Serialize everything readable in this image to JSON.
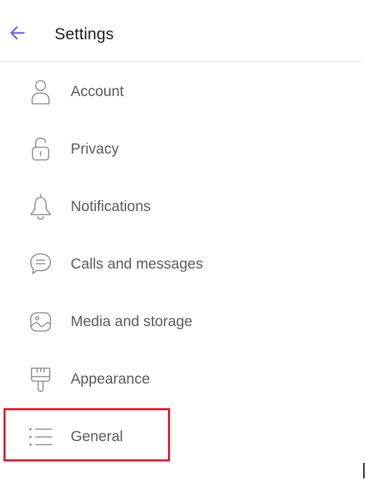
{
  "header": {
    "title": "Settings",
    "back_icon": "arrow-left-icon",
    "accent_color": "#7360f2"
  },
  "menu": {
    "items": [
      {
        "id": "account",
        "label": "Account",
        "icon": "person-icon"
      },
      {
        "id": "privacy",
        "label": "Privacy",
        "icon": "lock-icon"
      },
      {
        "id": "notifications",
        "label": "Notifications",
        "icon": "bell-icon"
      },
      {
        "id": "calls-messages",
        "label": "Calls and messages",
        "icon": "chat-bubble-icon"
      },
      {
        "id": "media-storage",
        "label": "Media and storage",
        "icon": "image-icon"
      },
      {
        "id": "appearance",
        "label": "Appearance",
        "icon": "paint-brush-icon"
      },
      {
        "id": "general",
        "label": "General",
        "icon": "list-icon"
      }
    ],
    "highlighted_item": "general",
    "highlight_color": "#e21b2c",
    "icon_color": "#8a8a8a"
  }
}
